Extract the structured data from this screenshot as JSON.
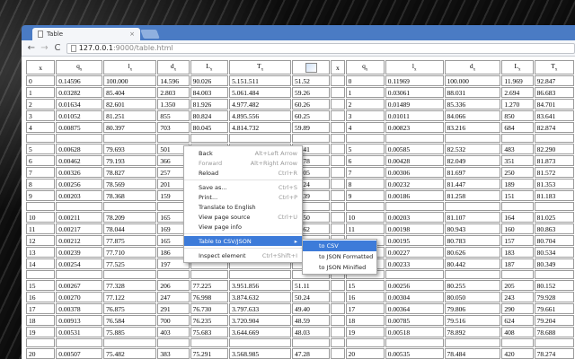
{
  "window": {
    "tab_title": "Table",
    "tab_close": "×"
  },
  "address": {
    "host": "127.0.0.1",
    "path": ":9000/table.html"
  },
  "nav": {
    "back": "←",
    "forward": "→",
    "reload": "C"
  },
  "table": {
    "headers": [
      "x",
      "q",
      "l",
      "d",
      "L",
      "T",
      "",
      "x",
      "q",
      "l",
      "d",
      "L",
      "T"
    ],
    "header_subs": [
      "",
      "x",
      "x",
      "x",
      "x",
      "x",
      "",
      "",
      "x",
      "x",
      "x",
      "x",
      "x"
    ],
    "rows": [
      [
        "0",
        "0.14596",
        "100.000",
        "14.596",
        "90.026",
        "5.151.511",
        "51.52",
        "0",
        "0.11969",
        "100.000",
        "11.969",
        "92.847"
      ],
      [
        "1",
        "0.03282",
        "85.404",
        "2.803",
        "84.003",
        "5.061.484",
        "59.26",
        "1",
        "0.03061",
        "88.031",
        "2.694",
        "86.683"
      ],
      [
        "2",
        "0.01634",
        "82.601",
        "1.350",
        "81.926",
        "4.977.482",
        "60.26",
        "2",
        "0.01489",
        "85.336",
        "1.270",
        "84.701"
      ],
      [
        "3",
        "0.01052",
        "81.251",
        "855",
        "80.824",
        "4.895.556",
        "60.25",
        "3",
        "0.01011",
        "84.066",
        "850",
        "83.641"
      ],
      [
        "4",
        "0.00875",
        "80.397",
        "703",
        "80.045",
        "4.814.732",
        "59.89",
        "4",
        "0.00823",
        "83.216",
        "684",
        "82.874"
      ],
      null,
      [
        "5",
        "0.00628",
        "79.693",
        "501",
        "",
        "4.734.687",
        "59.41",
        "5",
        "0.00585",
        "82.532",
        "483",
        "82.290"
      ],
      [
        "6",
        "0.00462",
        "79.193",
        "366",
        "",
        "",
        "58.78",
        "6",
        "0.00428",
        "82.049",
        "351",
        "81.873"
      ],
      [
        "7",
        "0.00326",
        "78.827",
        "257",
        "",
        "",
        "58.05",
        "7",
        "0.00306",
        "81.697",
        "250",
        "81.572"
      ],
      [
        "8",
        "0.00256",
        "78.569",
        "201",
        "",
        "",
        "57.24",
        "8",
        "0.00232",
        "81.447",
        "189",
        "81.353"
      ],
      [
        "9",
        "0.00203",
        "78.368",
        "159",
        "",
        "",
        "56.39",
        "9",
        "0.00186",
        "81.258",
        "151",
        "81.183"
      ],
      null,
      [
        "10",
        "0.00211",
        "78.209",
        "165",
        "",
        "",
        "55.50",
        "10",
        "0.00203",
        "81.107",
        "164",
        "81.025"
      ],
      [
        "11",
        "0.00217",
        "78.044",
        "169",
        "",
        "",
        "54.62",
        "11",
        "0.00198",
        "80.943",
        "160",
        "80.863"
      ],
      [
        "12",
        "0.00212",
        "77.875",
        "165",
        "",
        "",
        "53.74",
        "12",
        "0.00195",
        "80.783",
        "157",
        "80.704"
      ],
      [
        "13",
        "0.00239",
        "77.710",
        "186",
        "",
        "",
        "52.85",
        "13",
        "0.00227",
        "80.626",
        "183",
        "80.534"
      ],
      [
        "14",
        "0.00254",
        "77.525",
        "197",
        "",
        "",
        "",
        "14",
        "0.00233",
        "80.442",
        "187",
        "80.349"
      ],
      null,
      [
        "15",
        "0.00267",
        "77.328",
        "206",
        "77.225",
        "3.951.856",
        "51.11",
        "15",
        "0.00256",
        "80.255",
        "205",
        "80.152"
      ],
      [
        "16",
        "0.00270",
        "77.122",
        "247",
        "76.998",
        "3.874.632",
        "50.24",
        "16",
        "0.00304",
        "80.050",
        "243",
        "79.928"
      ],
      [
        "17",
        "0.00378",
        "76.875",
        "291",
        "76.730",
        "3.797.633",
        "49.40",
        "17",
        "0.00364",
        "79.806",
        "290",
        "79.661"
      ],
      [
        "18",
        "0.00913",
        "76.584",
        "700",
        "76.235",
        "3.720.904",
        "48.59",
        "18",
        "0.00785",
        "79.516",
        "624",
        "79.204"
      ],
      [
        "19",
        "0.00531",
        "75.885",
        "403",
        "75.683",
        "3.644.669",
        "48.03",
        "19",
        "0.00518",
        "78.892",
        "408",
        "78.688"
      ],
      null,
      [
        "20",
        "0.00507",
        "75.482",
        "383",
        "75.291",
        "3.568.985",
        "47.28",
        "20",
        "0.00535",
        "78.484",
        "420",
        "78.274"
      ],
      [
        "21",
        "0.00547",
        "75.099",
        "433",
        "74.860",
        "3.493.694",
        "46.57",
        "21",
        "0.00553",
        "78.064",
        "431",
        "77.848"
      ]
    ]
  },
  "context_menu": {
    "items": [
      {
        "label": "Back",
        "shortcut": "Alt+Left Arrow",
        "disabled": false
      },
      {
        "label": "Forward",
        "shortcut": "Alt+Right Arrow",
        "disabled": true
      },
      {
        "label": "Reload",
        "shortcut": "Ctrl+R",
        "disabled": false
      },
      {
        "sep": true
      },
      {
        "label": "Save as...",
        "shortcut": "Ctrl+S",
        "disabled": false
      },
      {
        "label": "Print...",
        "shortcut": "Ctrl+P",
        "disabled": false
      },
      {
        "label": "Translate to English",
        "shortcut": "",
        "disabled": false
      },
      {
        "label": "View page source",
        "shortcut": "Ctrl+U",
        "disabled": false
      },
      {
        "label": "View page info",
        "shortcut": "",
        "disabled": false
      },
      {
        "sep": true
      },
      {
        "label": "Table to CSV/JSON",
        "shortcut": "▸",
        "disabled": false,
        "active": true
      },
      {
        "sep": true
      },
      {
        "label": "Inspect element",
        "shortcut": "Ctrl+Shift+I",
        "disabled": false
      }
    ]
  },
  "submenu": {
    "items": [
      {
        "label": "to CSV",
        "active": true
      },
      {
        "label": "to JSON Formatted",
        "active": false
      },
      {
        "label": "to JSON Minified",
        "active": false
      }
    ]
  },
  "colors": {
    "accent": "#3d7bd9",
    "frame": "#4a7bc4"
  }
}
